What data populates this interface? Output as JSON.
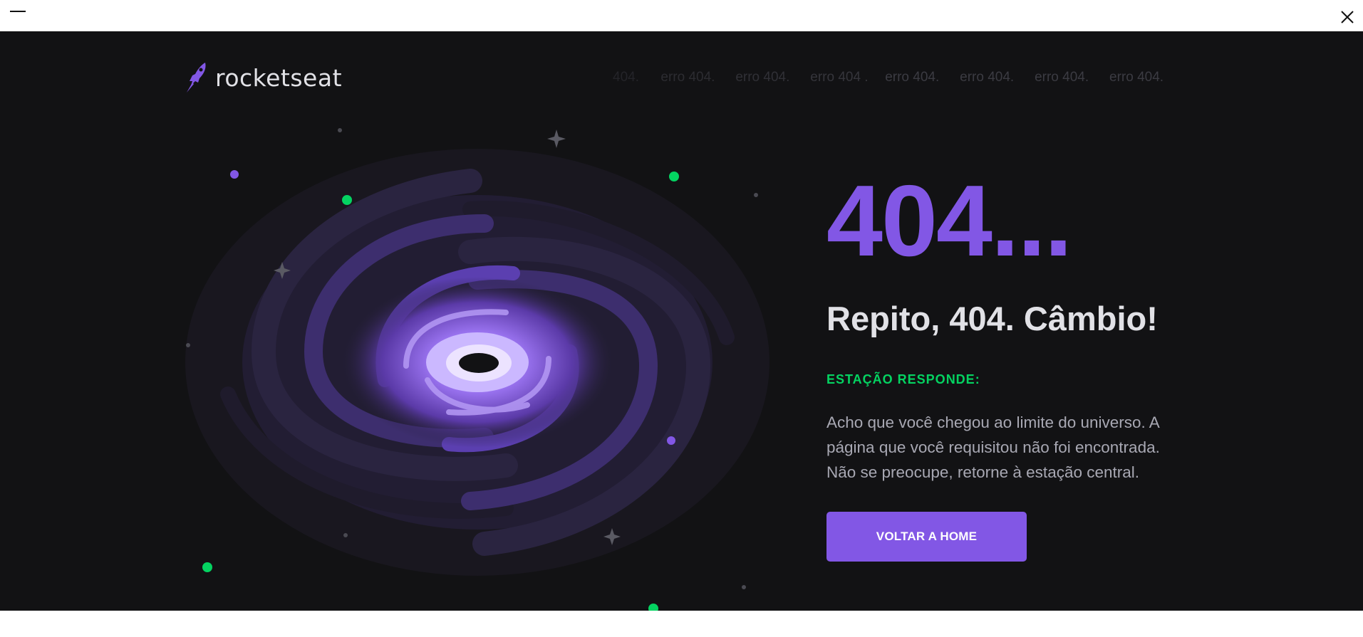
{
  "window": {
    "minimize_icon": "minimize-icon",
    "close_icon": "close-icon"
  },
  "header": {
    "logo_text": "rocketseat",
    "logo_icon": "rocket-icon",
    "marquee": [
      "404.",
      "erro 404.",
      "erro 404.",
      "erro 404 .",
      "erro 404.",
      "erro 404.",
      "erro 404.",
      "erro 404."
    ]
  },
  "main": {
    "code": "404...",
    "headline": "Repito, 404. Câmbio!",
    "tag": "ESTAÇÃO RESPONDE:",
    "message": "Acho que você chegou ao limite do universo. A página que você requisitou não foi encontrada. Não se preocupe, retorne à estação central.",
    "button_label": "VOLTAR A HOME"
  },
  "colors": {
    "background": "#121214",
    "accent": "#8257e5",
    "success": "#04d361",
    "title": "#e1e1e6",
    "text": "#a8a8b3"
  },
  "illustration": "galaxy-illustration"
}
